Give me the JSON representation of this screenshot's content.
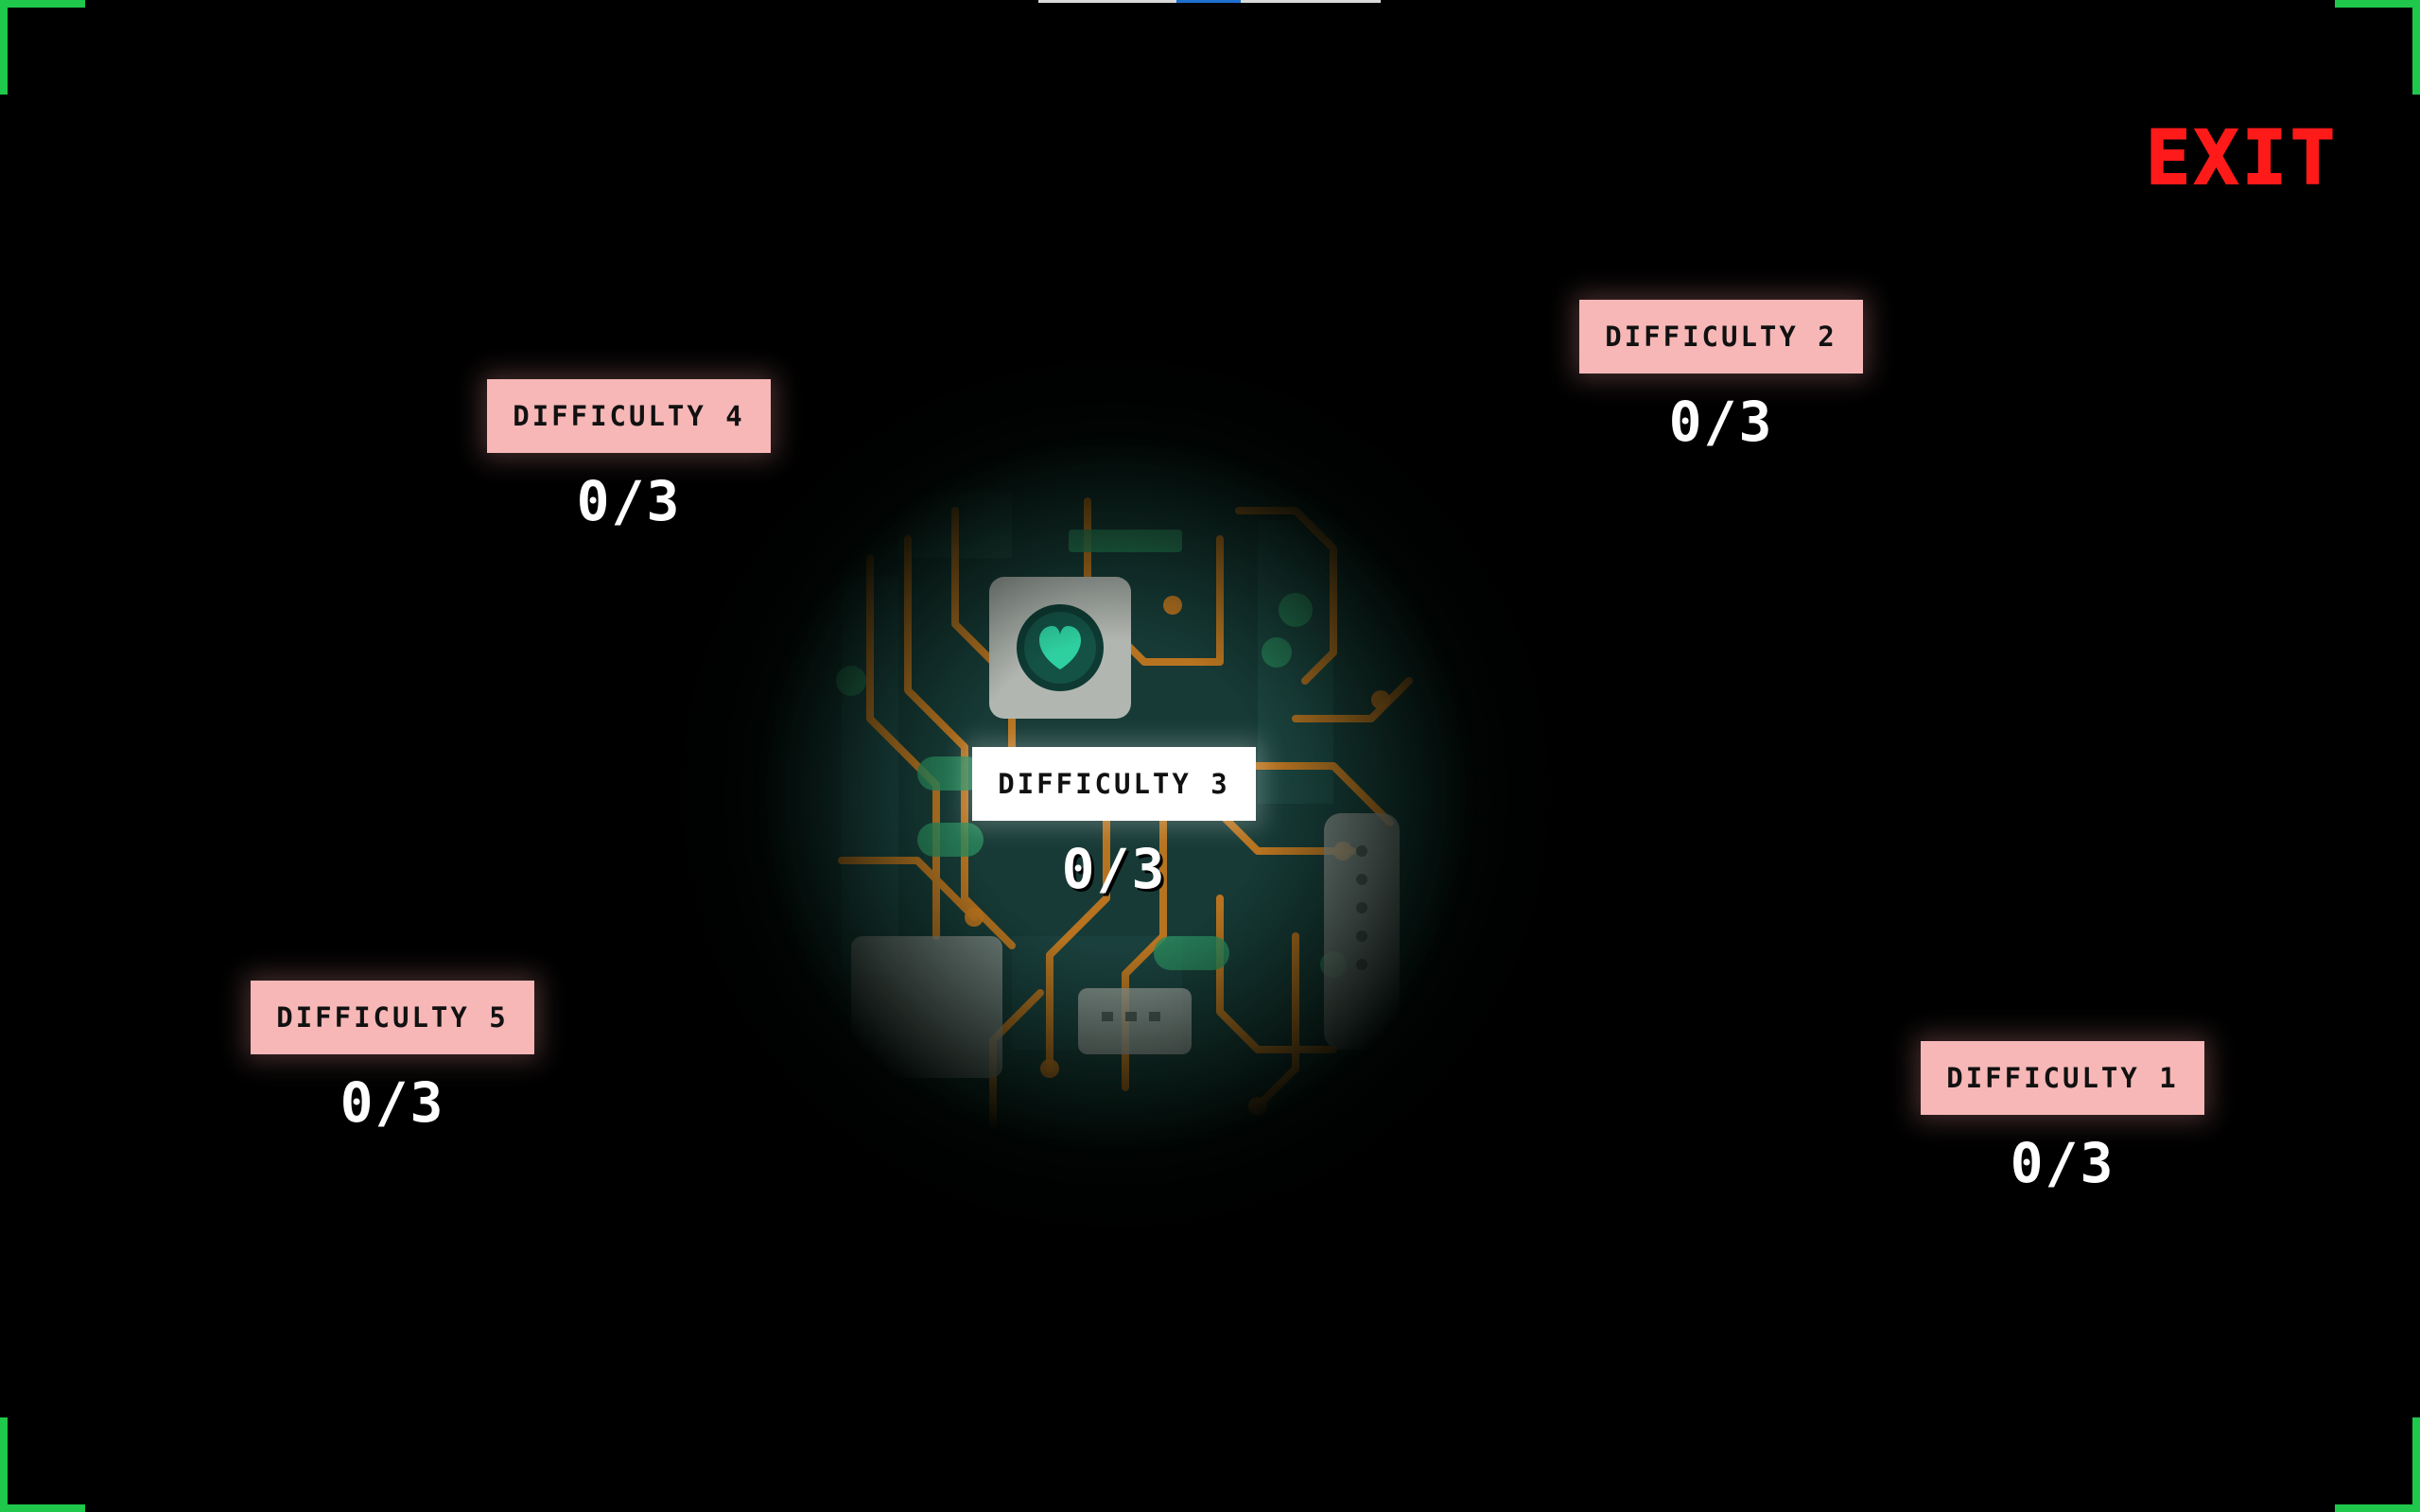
{
  "exit_label": "EXIT",
  "levels": [
    {
      "label": "DIFFICULTY 1",
      "score": "0/3",
      "selected": false
    },
    {
      "label": "DIFFICULTY 2",
      "score": "0/3",
      "selected": false
    },
    {
      "label": "DIFFICULTY 3",
      "score": "0/3",
      "selected": true
    },
    {
      "label": "DIFFICULTY 4",
      "score": "0/3",
      "selected": false
    },
    {
      "label": "DIFFICULTY 5",
      "score": "0/3",
      "selected": false
    }
  ],
  "colors": {
    "background": "#000000",
    "corner_brackets": "#1fc74a",
    "exit": "#ff1a1a",
    "level_button": "#f7b7b7",
    "level_button_selected": "#ffffff",
    "circuit_board": "#1d4a44",
    "circuit_traces": "#d07a1c"
  },
  "icons": {
    "center_chip": "heart-chip-icon"
  }
}
